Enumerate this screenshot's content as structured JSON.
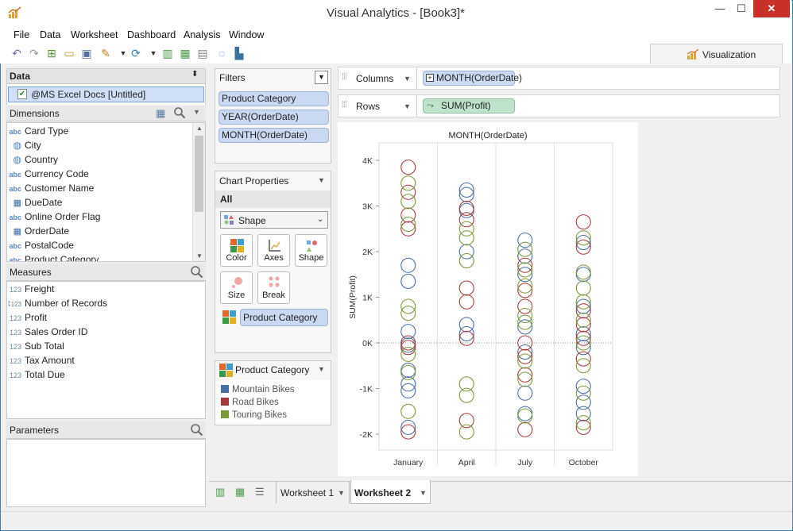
{
  "window": {
    "title": "Visual Analytics - [Book3]*",
    "minimize": "—",
    "maximize": "☐",
    "close": "✕"
  },
  "menu": [
    "File",
    "Data",
    "Worksheet",
    "Dashboard",
    "Analysis",
    "Window"
  ],
  "visualization_tab": "Visualization",
  "data_panel": {
    "header": "Data",
    "source": "@MS Excel Docs [Untitled]"
  },
  "dimensions": {
    "header": "Dimensions",
    "items": [
      {
        "type": "abc",
        "label": "Card Type"
      },
      {
        "type": "globe",
        "label": "City"
      },
      {
        "type": "globe",
        "label": "Country"
      },
      {
        "type": "abc",
        "label": "Currency Code"
      },
      {
        "type": "abc",
        "label": "Customer Name"
      },
      {
        "type": "date",
        "label": "DueDate"
      },
      {
        "type": "abc",
        "label": "Online Order Flag"
      },
      {
        "type": "date",
        "label": "OrderDate"
      },
      {
        "type": "abc",
        "label": "PostalCode"
      },
      {
        "type": "abc",
        "label": "Product Category"
      }
    ]
  },
  "measures": {
    "header": "Measures",
    "items": [
      {
        "type": "123",
        "label": "Freight"
      },
      {
        "type": "#123",
        "label": "Number of Records"
      },
      {
        "type": "123",
        "label": "Profit"
      },
      {
        "type": "123",
        "label": "Sales Order ID"
      },
      {
        "type": "123",
        "label": "Sub Total"
      },
      {
        "type": "123",
        "label": "Tax Amount"
      },
      {
        "type": "123",
        "label": "Total Due"
      }
    ]
  },
  "parameters": {
    "header": "Parameters"
  },
  "filters": {
    "header": "Filters",
    "items": [
      "Product Category",
      "YEAR(OrderDate)",
      "MONTH(OrderDate)"
    ]
  },
  "chart_properties": {
    "header": "Chart Properties",
    "scope": "All",
    "mark_type": "Shape",
    "buttons": [
      "Color",
      "Axes",
      "Shape",
      "Size",
      "Break"
    ],
    "color_field": "Product Category"
  },
  "legend": {
    "header": "Product Category",
    "items": [
      {
        "label": "Mountain Bikes",
        "color": "#4a6fa5"
      },
      {
        "label": "Road Bikes",
        "color": "#a33b3b"
      },
      {
        "label": "Touring Bikes",
        "color": "#7a9a3a"
      }
    ]
  },
  "shelves": {
    "columns_label": "Columns",
    "columns_pill": "MONTH(OrderDate)",
    "rows_label": "Rows",
    "rows_pill": "SUM(Profit)"
  },
  "sheet_tabs": [
    "Worksheet 1",
    "Worksheet 2"
  ],
  "active_sheet": "Worksheet 2",
  "chart_data": {
    "type": "scatter",
    "title": "MONTH(OrderDate)",
    "xlabel": "",
    "ylabel": "SUM(Profit)",
    "categories": [
      "January",
      "April",
      "July",
      "October"
    ],
    "y_ticks": [
      "4K",
      "3K",
      "2K",
      "1K",
      "0K",
      "-1K",
      "-2K"
    ],
    "ylim": [
      -2300,
      4300
    ],
    "reference_line": 0,
    "marker": "hollow circle",
    "series": [
      {
        "name": "Mountain Bikes",
        "color": "#4a6fa5",
        "points": [
          [
            0,
            1700
          ],
          [
            0,
            1350
          ],
          [
            0,
            250
          ],
          [
            0,
            -50
          ],
          [
            0,
            -600
          ],
          [
            0,
            -900
          ],
          [
            0,
            -1050
          ],
          [
            0,
            -1850
          ],
          [
            1,
            3350
          ],
          [
            1,
            3250
          ],
          [
            1,
            2900
          ],
          [
            1,
            2000
          ],
          [
            1,
            400
          ],
          [
            1,
            200
          ],
          [
            2,
            2250
          ],
          [
            2,
            1900
          ],
          [
            2,
            1500
          ],
          [
            2,
            350
          ],
          [
            2,
            -200
          ],
          [
            2,
            -1100
          ],
          [
            2,
            -1550
          ],
          [
            3,
            2200
          ],
          [
            3,
            1500
          ],
          [
            3,
            800
          ],
          [
            3,
            200
          ],
          [
            3,
            -100
          ],
          [
            3,
            -950
          ],
          [
            3,
            -1300
          ],
          [
            3,
            -1550
          ]
        ]
      },
      {
        "name": "Road Bikes",
        "color": "#a33b3b",
        "points": [
          [
            0,
            3850
          ],
          [
            0,
            3300
          ],
          [
            0,
            2800
          ],
          [
            0,
            2500
          ],
          [
            0,
            -100
          ],
          [
            0,
            0
          ],
          [
            0,
            -1950
          ],
          [
            1,
            2950
          ],
          [
            1,
            2700
          ],
          [
            1,
            1200
          ],
          [
            1,
            900
          ],
          [
            1,
            100
          ],
          [
            1,
            -1700
          ],
          [
            2,
            1700
          ],
          [
            2,
            1150
          ],
          [
            2,
            800
          ],
          [
            2,
            0
          ],
          [
            2,
            -300
          ],
          [
            2,
            -700
          ],
          [
            2,
            -1900
          ],
          [
            3,
            2650
          ],
          [
            3,
            2100
          ],
          [
            3,
            700
          ],
          [
            3,
            400
          ],
          [
            3,
            100
          ],
          [
            3,
            -350
          ],
          [
            3,
            -1850
          ]
        ]
      },
      {
        "name": "Touring Bikes",
        "color": "#7a9a3a",
        "points": [
          [
            0,
            3500
          ],
          [
            0,
            3100
          ],
          [
            0,
            2600
          ],
          [
            0,
            800
          ],
          [
            0,
            650
          ],
          [
            0,
            -250
          ],
          [
            0,
            -650
          ],
          [
            0,
            -1500
          ],
          [
            1,
            2500
          ],
          [
            1,
            2300
          ],
          [
            1,
            1800
          ],
          [
            1,
            -900
          ],
          [
            1,
            -1150
          ],
          [
            1,
            -1950
          ],
          [
            2,
            2050
          ],
          [
            2,
            1600
          ],
          [
            2,
            1250
          ],
          [
            2,
            600
          ],
          [
            2,
            450
          ],
          [
            2,
            -400
          ],
          [
            2,
            -800
          ],
          [
            2,
            -1600
          ],
          [
            3,
            2300
          ],
          [
            3,
            1550
          ],
          [
            3,
            1200
          ],
          [
            3,
            900
          ],
          [
            3,
            500
          ],
          [
            3,
            0
          ],
          [
            3,
            -500
          ],
          [
            3,
            -1100
          ],
          [
            3,
            -1750
          ]
        ]
      }
    ]
  }
}
